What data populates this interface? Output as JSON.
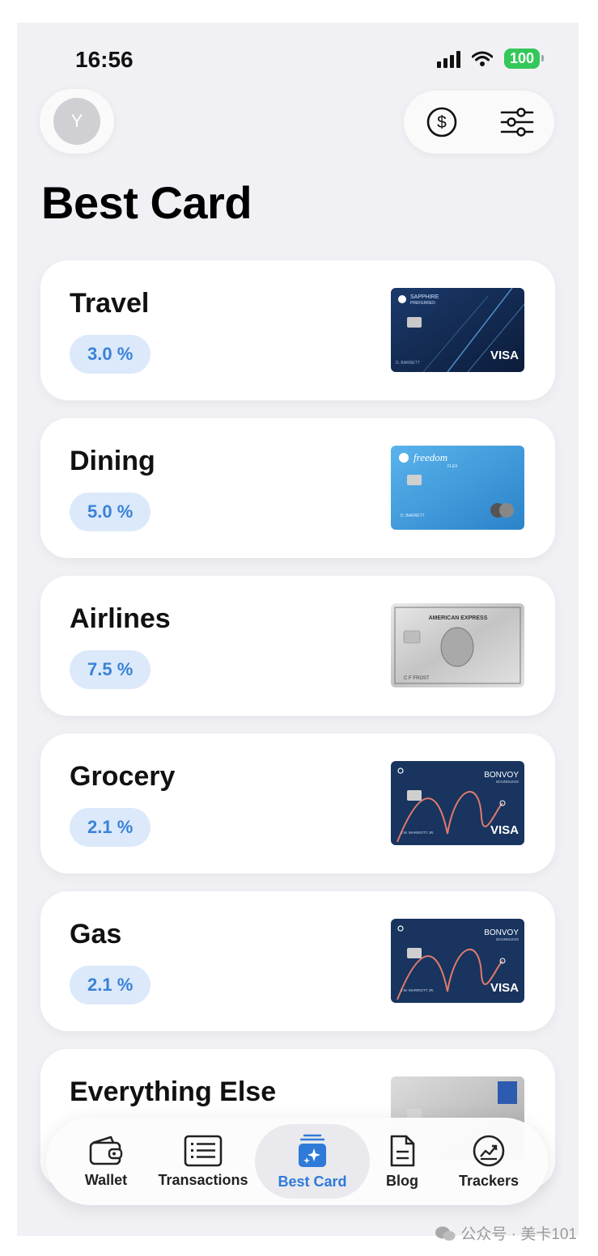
{
  "status_bar": {
    "time": "16:56",
    "battery": "100"
  },
  "header": {
    "avatar_initial": "Y",
    "title": "Best Card"
  },
  "categories": [
    {
      "name": "Travel",
      "rate": "3.0 %",
      "card": {
        "brand_text": "SAPPHIRE",
        "sub_text": "PREFERRED",
        "network": "VISA",
        "holder": "D. BARRETT"
      }
    },
    {
      "name": "Dining",
      "rate": "5.0 %",
      "card": {
        "brand_text": "freedom",
        "sub_text": "FLEX",
        "network": "",
        "holder": "D. BARRETT"
      }
    },
    {
      "name": "Airlines",
      "rate": "7.5 %",
      "card": {
        "brand_text": "AMERICAN EXPRESS",
        "sub_text": "",
        "network": "",
        "holder": "C F FROST"
      }
    },
    {
      "name": "Grocery",
      "rate": "2.1 %",
      "card": {
        "brand_text": "BONVOY",
        "sub_text": "BOUNDLESS",
        "network": "VISA",
        "holder": "J.W. MARRIOTT JR."
      }
    },
    {
      "name": "Gas",
      "rate": "2.1 %",
      "card": {
        "brand_text": "BONVOY",
        "sub_text": "BOUNDLESS",
        "network": "VISA",
        "holder": "J.W. MARRIOTT JR."
      }
    },
    {
      "name": "Everything Else",
      "rate": "",
      "card": {
        "brand_text": "",
        "sub_text": "",
        "network": "",
        "holder": ""
      }
    }
  ],
  "tabs": [
    {
      "label": "Wallet",
      "icon": "wallet-icon",
      "active": false
    },
    {
      "label": "Transactions",
      "icon": "list-icon",
      "active": false
    },
    {
      "label": "Best Card",
      "icon": "sparkle-card-icon",
      "active": true
    },
    {
      "label": "Blog",
      "icon": "document-icon",
      "active": false
    },
    {
      "label": "Trackers",
      "icon": "chart-icon",
      "active": false
    }
  ],
  "colors": {
    "accent": "#2f7ad8",
    "badge_bg": "#dbe9fb",
    "badge_text": "#3a82d6",
    "screen_bg": "#f1f1f5"
  },
  "watermark": "公众号 · 美卡101"
}
